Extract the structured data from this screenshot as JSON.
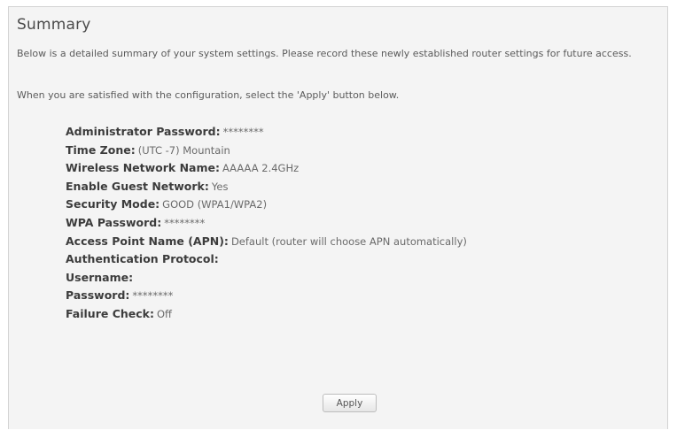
{
  "summary": {
    "title": "Summary",
    "intro": "Below is a detailed summary of your system settings. Please record these newly established router settings for future access.",
    "instruction": "When you are satisfied with the configuration, select the 'Apply' button below.",
    "settings": [
      {
        "label": "Administrator Password:",
        "value": "********"
      },
      {
        "label": "Time Zone:",
        "value": "(UTC -7) Mountain"
      },
      {
        "label": "Wireless Network Name:",
        "value": "AAAAA 2.4GHz"
      },
      {
        "label": "Enable Guest Network:",
        "value": "Yes"
      },
      {
        "label": "Security Mode:",
        "value": "GOOD (WPA1/WPA2)"
      },
      {
        "label": "WPA Password:",
        "value": "********"
      },
      {
        "label": "Access Point Name (APN):",
        "value": "Default (router will choose APN automatically)"
      },
      {
        "label": "Authentication Protocol:",
        "value": ""
      },
      {
        "label": "Username:",
        "value": ""
      },
      {
        "label": "Password:",
        "value": "********"
      },
      {
        "label": "Failure Check:",
        "value": "Off"
      }
    ],
    "apply_label": "Apply"
  }
}
